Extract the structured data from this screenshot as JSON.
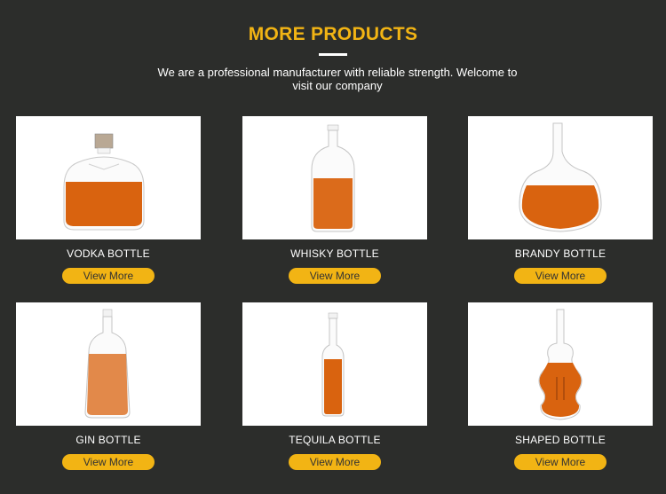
{
  "header": {
    "title": "MORE PRODUCTS",
    "subtitle": "We are a professional manufacturer with reliable strength. Welcome to visit our company"
  },
  "colors": {
    "accent": "#f2b414",
    "background": "#2c2d2b",
    "liquid": "#d9630f"
  },
  "products": [
    {
      "name": "VODKA BOTTLE",
      "button": "View More"
    },
    {
      "name": "WHISKY BOTTLE",
      "button": "View More"
    },
    {
      "name": "BRANDY BOTTLE",
      "button": "View More"
    },
    {
      "name": "GIN BOTTLE",
      "button": "View More"
    },
    {
      "name": "TEQUILA BOTTLE",
      "button": "View More"
    },
    {
      "name": "SHAPED BOTTLE",
      "button": "View More"
    }
  ]
}
